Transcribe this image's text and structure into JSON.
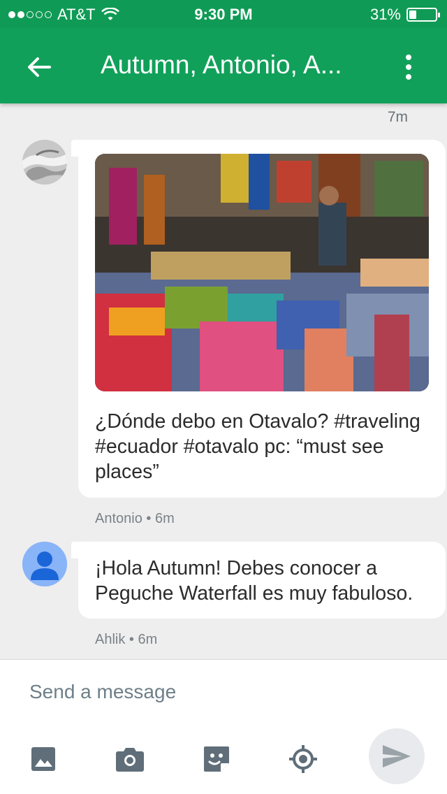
{
  "status_bar": {
    "carrier": "AT&T",
    "time": "9:30 PM",
    "battery": "31%",
    "signal_bars_full": 2,
    "signal_bars_total": 5,
    "battery_level": 0.31
  },
  "header": {
    "title": "Autumn, Antonio, A...",
    "back_icon": "arrow-left-icon",
    "menu_icon": "more-vert-icon",
    "color": "#11a05a"
  },
  "conversation": {
    "top_timestamp": "7m",
    "messages": [
      {
        "avatar": "photo-avatar",
        "has_image": true,
        "image_description": "market-textiles-photo",
        "text": "¿Dónde debo en Otavalo? #traveling #ecuador #otavalo  pc: “must see places”",
        "meta": "Antonio • 6m"
      },
      {
        "avatar": "default-person-avatar",
        "has_image": false,
        "text": "¡Hola Autumn! Debes conocer a Peguche Waterfall es muy fabuloso.",
        "meta": "Ahlik • 6m"
      }
    ]
  },
  "composer": {
    "placeholder": "Send a message",
    "icons": [
      "image-icon",
      "camera-icon",
      "sticker-icon",
      "location-icon",
      "send-icon"
    ]
  }
}
